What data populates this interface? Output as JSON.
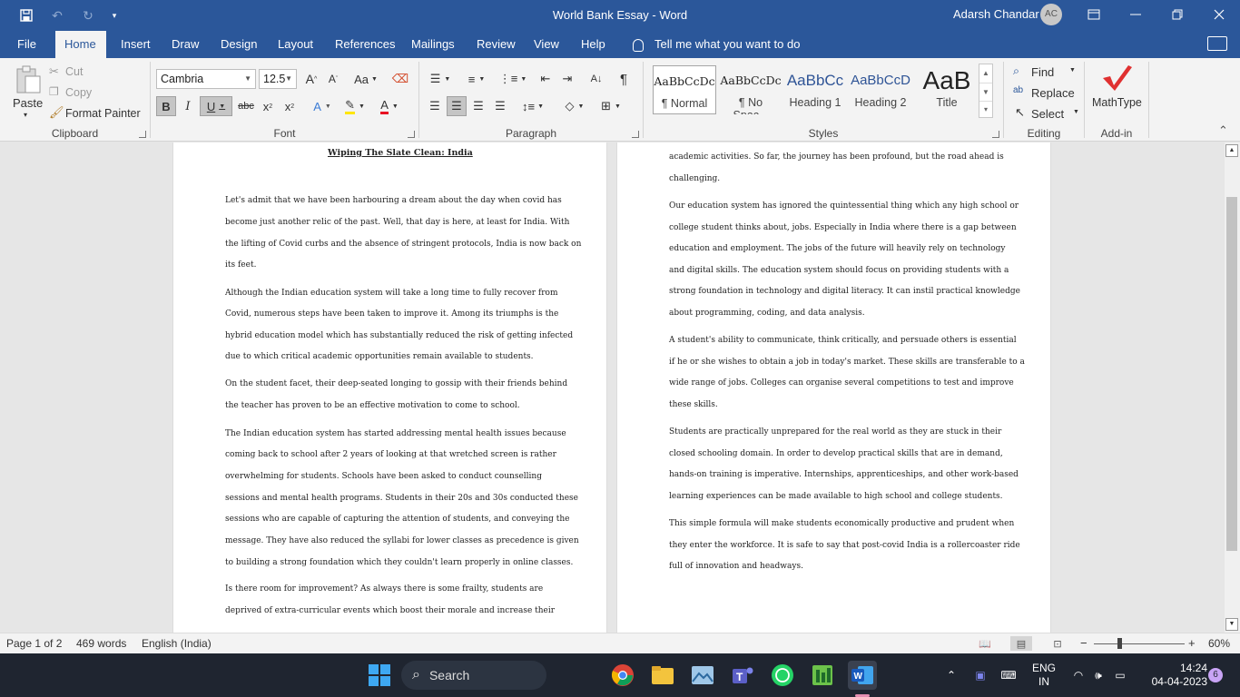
{
  "window": {
    "title": "World Bank Essay  -  Word",
    "user_name": "Adarsh Chandar",
    "user_initials": "AC"
  },
  "tabs": [
    {
      "label": "File"
    },
    {
      "label": "Home"
    },
    {
      "label": "Insert"
    },
    {
      "label": "Draw"
    },
    {
      "label": "Design"
    },
    {
      "label": "Layout"
    },
    {
      "label": "References"
    },
    {
      "label": "Mailings"
    },
    {
      "label": "Review"
    },
    {
      "label": "View"
    },
    {
      "label": "Help"
    }
  ],
  "tell_me": "Tell me what you want to do",
  "ribbon": {
    "clipboard": {
      "paste": "Paste",
      "cut": "Cut",
      "copy": "Copy",
      "format_painter": "Format Painter",
      "label": "Clipboard"
    },
    "font": {
      "family": "Cambria",
      "size": "12.5",
      "label": "Font",
      "change_case": "Aa",
      "grow": "A",
      "shrink": "A"
    },
    "paragraph": {
      "label": "Paragraph"
    },
    "styles": {
      "label": "Styles",
      "items": [
        {
          "preview": "AaBbCcDc",
          "name": "¶ Normal"
        },
        {
          "preview": "AaBbCcDc",
          "name": "¶ No Spac..."
        },
        {
          "preview": "AaBbCc",
          "name": "Heading 1"
        },
        {
          "preview": "AaBbCcD",
          "name": "Heading 2"
        },
        {
          "preview": "AaB",
          "name": "Title"
        }
      ]
    },
    "editing": {
      "find": "Find",
      "replace": "Replace",
      "select": "Select",
      "label": "Editing"
    },
    "addin": {
      "mathtype": "MathType",
      "label": "Add-in"
    }
  },
  "document": {
    "heading": "Wiping The Slate Clean: India",
    "left_lines": [
      "Let's admit that we have been harbouring a dream about the day when covid has",
      "become just another relic of the past. Well, that day is here, at least for India. With",
      "the lifting of Covid curbs and the absence of stringent protocols, India is now back on",
      "its feet.",
      "Although the Indian education system will take a long time to fully recover from",
      "Covid, numerous steps have been taken to improve it. Among its triumphs is the",
      "hybrid education model which has substantially reduced the risk of getting infected",
      "due to which critical academic opportunities remain available to students.",
      "On the student facet, their deep-seated longing to gossip with their friends behind",
      "the teacher has proven to be an effective motivation to come to school.",
      "The Indian education system has started addressing mental health issues because",
      "coming back to school after 2 years of looking at that wretched screen is rather",
      "overwhelming for students.  Schools have been asked to conduct counselling",
      "sessions and mental health programs. Students in their 20s and 30s conducted these",
      "sessions who are capable of capturing the attention of students, and conveying the",
      "message. They have also reduced the syllabi for lower classes as precedence is given",
      "to building a strong foundation which they couldn't learn properly in online classes.",
      "Is there room for improvement? As always there is some frailty, students are",
      "deprived of extra-curricular events which boost their morale and increase their"
    ],
    "right_lines": [
      "academic activities. So far, the journey has been profound, but the road ahead is",
      "challenging.",
      "Our education system has ignored the quintessential thing which any high school or",
      "college student thinks about, jobs. Especially in India where there is a gap between",
      "education and employment. The jobs of the future will heavily rely on technology",
      "and digital skills. The education system should focus on providing students with a",
      "strong foundation in technology and digital literacy. It can instil practical knowledge",
      "about programming, coding, and data analysis.",
      "A student's ability to communicate, think critically, and persuade others is essential",
      "if he or she wishes to obtain a job in today's market. These skills are transferable to a",
      "wide range of jobs. Colleges can organise several competitions to test and improve",
      "these skills.",
      "Students are practically unprepared for the real world as they are stuck in their",
      "closed schooling domain. In order to develop practical skills that are in demand,",
      "hands-on training is imperative. Internships, apprenticeships, and other work-based",
      "learning experiences can be made available to high school and college students.",
      "This simple formula will make students economically productive and prudent when",
      "they enter the workforce. It is safe to say that post-covid India is a rollercoaster ride",
      "full of innovation and headways."
    ]
  },
  "status": {
    "page": "Page 1 of 2",
    "words": "469 words",
    "language": "English (India)",
    "zoom": "60%",
    "zoom_minus": "−",
    "zoom_plus": "+"
  },
  "taskbar": {
    "search": "Search",
    "lang_top": "ENG",
    "lang_bottom": "IN",
    "time": "14:24",
    "date": "04-04-2023",
    "notifications": "6"
  },
  "colors": {
    "word_blue": "#2b579a",
    "ribbon_bg": "#f3f3f3",
    "taskbar_bg": "#1f2530"
  }
}
